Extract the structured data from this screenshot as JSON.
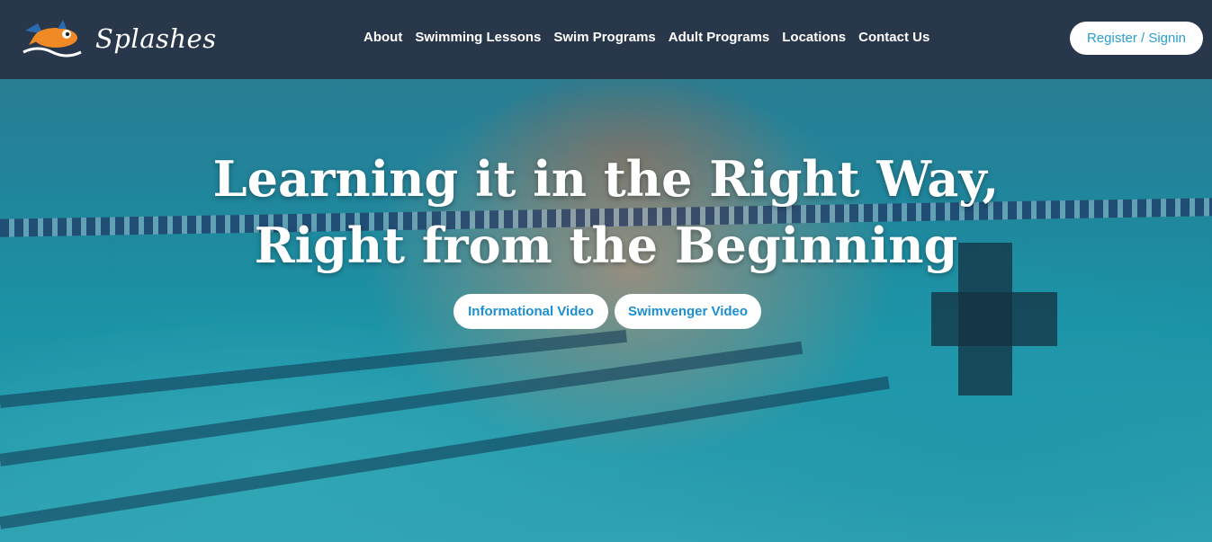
{
  "brand": {
    "name": "Splashes",
    "logo_icon": "splashes-shark-mascot-icon"
  },
  "nav": {
    "items": [
      {
        "label": "About"
      },
      {
        "label": "Swimming Lessons"
      },
      {
        "label": "Swim Programs"
      },
      {
        "label": "Adult Programs"
      },
      {
        "label": "Locations"
      },
      {
        "label": "Contact Us"
      }
    ]
  },
  "header": {
    "register_label": "Register / Signin"
  },
  "hero": {
    "headline_line1": "Learning it in the Right Way,",
    "headline_line2": "Right from the Beginning",
    "buttons": [
      {
        "label": "Informational Video"
      },
      {
        "label": "Swimvenger Video"
      }
    ]
  },
  "colors": {
    "accent": "#2a9fd0",
    "header_bg": "#28283c",
    "water": "#21aec2"
  }
}
